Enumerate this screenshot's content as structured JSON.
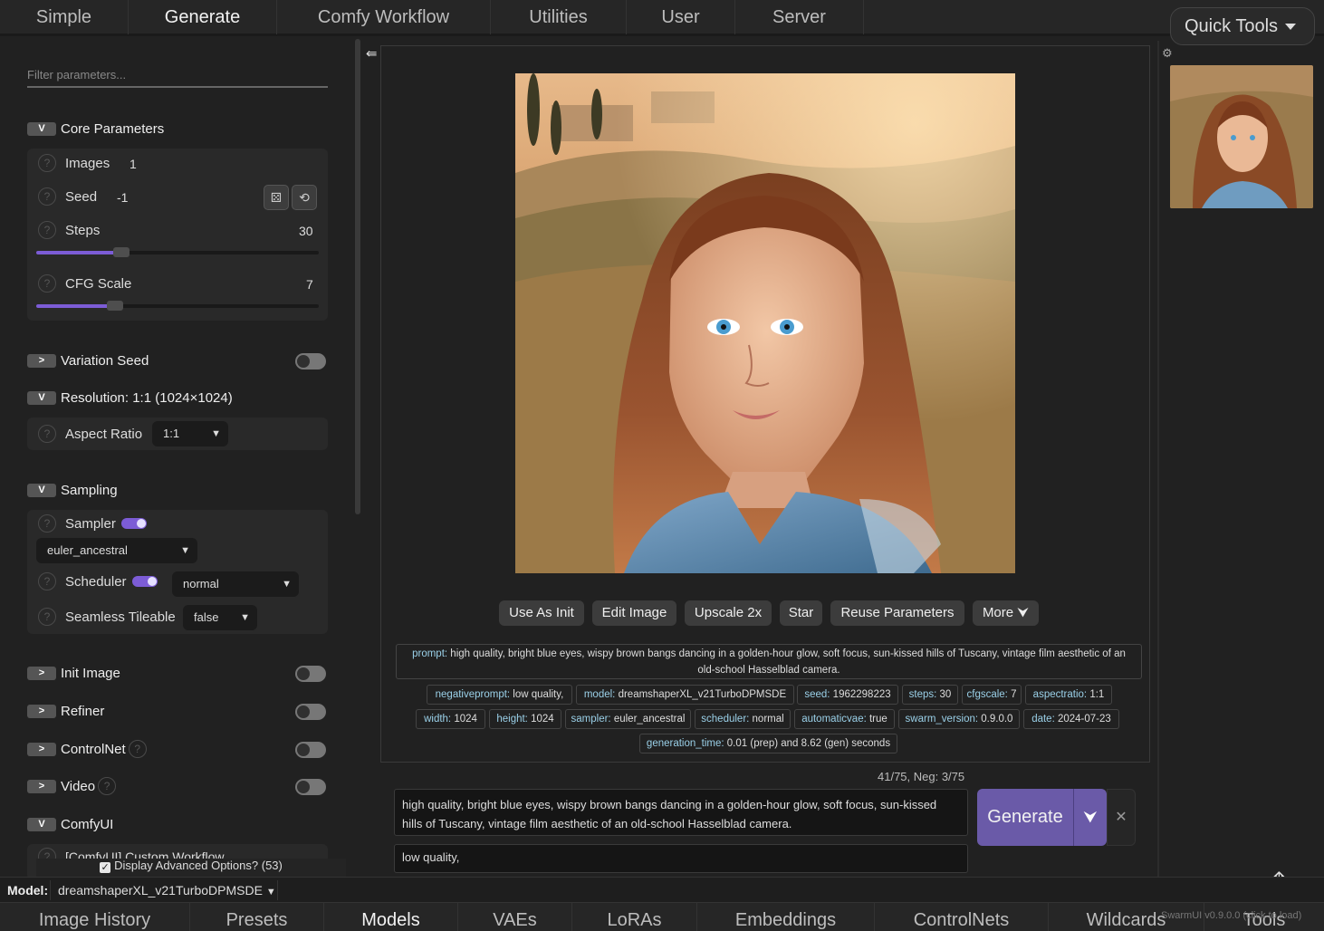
{
  "top_tabs": [
    "Simple",
    "Generate",
    "Comfy Workflow",
    "Utilities",
    "User",
    "Server"
  ],
  "quick_tools": "Quick Tools",
  "filter_placeholder": "Filter parameters...",
  "core": {
    "title": "Core Parameters",
    "images_label": "Images",
    "images_value": "1",
    "seed_label": "Seed",
    "seed_value": "-1",
    "steps_label": "Steps",
    "steps_value": "30",
    "steps_fraction": 0.3,
    "cfg_label": "CFG Scale",
    "cfg_value": "7",
    "cfg_fraction": 0.28
  },
  "variation_seed": "Variation Seed",
  "resolution": {
    "title": "Resolution: 1:1 (1024×1024)",
    "aspect_label": "Aspect Ratio",
    "aspect_value": "1:1"
  },
  "sampling": {
    "title": "Sampling",
    "sampler_label": "Sampler",
    "sampler_value": "euler_ancestral",
    "scheduler_label": "Scheduler",
    "scheduler_value": "normal",
    "seamless_label": "Seamless Tileable",
    "seamless_value": "false"
  },
  "groups": {
    "init_image": "Init Image",
    "refiner": "Refiner",
    "controlnet": "ControlNet",
    "video": "Video",
    "comfyui": "ComfyUI",
    "comfy_partial": "[ComfyUI] Custom Workflow"
  },
  "advanced_options": "Display Advanced Options? (53)",
  "actions": [
    "Use As Init",
    "Edit Image",
    "Upscale 2x",
    "Star",
    "Reuse Parameters",
    "More"
  ],
  "metadata": {
    "prompt_key": "prompt:",
    "prompt_val": " high quality, bright blue eyes, wispy brown bangs dancing in a golden-hour glow, soft focus, sun-kissed hills of Tuscany, vintage film aesthetic of an old-school Hasselblad camera.",
    "row1": [
      {
        "k": "negativeprompt:",
        "v": " low quality,"
      },
      {
        "k": "model:",
        "v": " dreamshaperXL_v21TurboDPMSDE"
      },
      {
        "k": "seed:",
        "v": " 1962298223"
      },
      {
        "k": "steps:",
        "v": " 30"
      },
      {
        "k": "cfgscale:",
        "v": " 7"
      },
      {
        "k": "aspectratio:",
        "v": " 1:1"
      }
    ],
    "row2": [
      {
        "k": "width:",
        "v": " 1024"
      },
      {
        "k": "height:",
        "v": " 1024"
      },
      {
        "k": "sampler:",
        "v": " euler_ancestral"
      },
      {
        "k": "scheduler:",
        "v": " normal"
      },
      {
        "k": "automaticvae:",
        "v": " true"
      },
      {
        "k": "swarm_version:",
        "v": " 0.9.0.0"
      },
      {
        "k": "date:",
        "v": " 2024-07-23"
      }
    ],
    "row3": [
      {
        "k": "generation_time:",
        "v": " 0.01 (prep) and 8.62 (gen) seconds"
      }
    ]
  },
  "token_count": "41/75, Neg: 3/75",
  "prompt_text": "high quality, bright blue eyes, wispy brown bangs dancing in a golden-hour glow, soft focus, sun-kissed hills of Tuscany, vintage film aesthetic of an old-school Hasselblad camera.",
  "negative_text": "low quality,",
  "generate_label": "Generate",
  "model_label": "Model:",
  "model_value": "dreamshaperXL_v21TurboDPMSDE",
  "bottom_tabs": [
    "Image History",
    "Presets",
    "Models",
    "VAEs",
    "LoRAs",
    "Embeddings",
    "ControlNets",
    "Wildcards",
    "Tools"
  ],
  "version": "SwarmUI v0.9.0.0 (click to load)",
  "colors": {
    "accent": "#7c5cd6",
    "generate": "#6a5aa8",
    "meta_key": "#9ad0e8"
  }
}
